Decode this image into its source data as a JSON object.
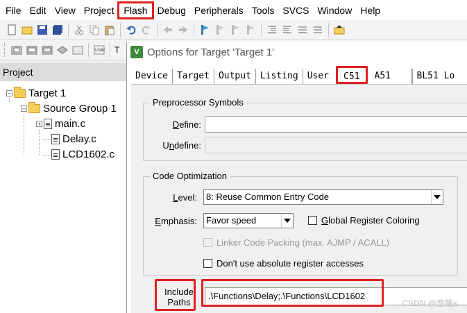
{
  "menu": [
    "File",
    "Edit",
    "View",
    "Project",
    "Flash",
    "Debug",
    "Peripherals",
    "Tools",
    "SVCS",
    "Window",
    "Help"
  ],
  "toolbar2_extra_label": "T",
  "project": {
    "header": "Project",
    "target": "Target 1",
    "group": "Source Group 1",
    "files": [
      "main.c",
      "Delay.c",
      "LCD1602.c"
    ]
  },
  "dialog": {
    "title": "Options for Target 'Target 1'",
    "app_icon_letter": "V",
    "tabs": [
      "Device",
      "Target",
      "Output",
      "Listing",
      "User",
      "C51",
      "A51",
      "BL51 Lo"
    ],
    "active_tab": "C51",
    "preprocessor": {
      "title": "Preprocessor Symbols",
      "define_label_u": "D",
      "define_label_rest": "efine:",
      "define_value": "",
      "undefine_label_pre": "U",
      "undefine_label_u": "n",
      "undefine_label_rest": "define:",
      "undefine_value": ""
    },
    "optimization": {
      "title": "Code Optimization",
      "level_label_u": "L",
      "level_label_rest": "evel:",
      "level_value": "8: Reuse Common Entry Code",
      "emphasis_label_u": "E",
      "emphasis_label_rest": "mphasis:",
      "emphasis_value": "Favor speed",
      "global_reg_label_u": "G",
      "global_reg_label_rest": "lobal Register Coloring",
      "linker_packing_label": "Linker Code Packing (max. AJMP / ACALL)",
      "abs_reg_label": "Don't use absolute register accesses"
    },
    "include": {
      "label_line1": "Include",
      "label_line2": "Paths",
      "value": ".\\Functions\\Delay;.\\Functions\\LCD1602"
    }
  },
  "watermark": "CSDN @悠眺s",
  "colors": {
    "highlight": "#e02020",
    "folder": "#f5cf5a",
    "keil_green": "#3d8a3a"
  }
}
